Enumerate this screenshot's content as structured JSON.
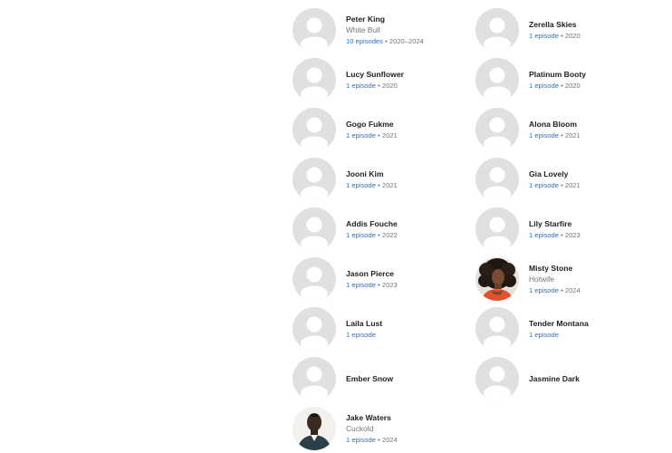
{
  "cast": {
    "left": [
      {
        "name": "Peter King",
        "role": "White Bull",
        "episodes": "10 episodes",
        "years": "2020–2024",
        "photo": false
      },
      {
        "name": "Lucy Sunflower",
        "role": "",
        "episodes": "1 episode",
        "years": "2020",
        "photo": false
      },
      {
        "name": "Gogo Fukme",
        "role": "",
        "episodes": "1 episode",
        "years": "2021",
        "photo": false
      },
      {
        "name": "Jooni Kim",
        "role": "",
        "episodes": "1 episode",
        "years": "2021",
        "photo": false
      },
      {
        "name": "Addis Fouche",
        "role": "",
        "episodes": "1 episode",
        "years": "2022",
        "photo": false
      },
      {
        "name": "Jason Pierce",
        "role": "",
        "episodes": "1 episode",
        "years": "2023",
        "photo": false
      },
      {
        "name": "Laila Lust",
        "role": "",
        "episodes": "1 episode",
        "years": "",
        "photo": false
      },
      {
        "name": "Ember Snow",
        "role": "",
        "episodes": "",
        "years": "",
        "photo": false
      },
      {
        "name": "Jake Waters",
        "role": "Cuckold",
        "episodes": "1 episode",
        "years": "2024",
        "photo": true
      }
    ],
    "right": [
      {
        "name": "Zerella Skies",
        "role": "",
        "episodes": "1 episode",
        "years": "2020",
        "photo": false
      },
      {
        "name": "Platinum Booty",
        "role": "",
        "episodes": "1 episode",
        "years": "2020",
        "photo": false
      },
      {
        "name": "Alona Bloom",
        "role": "",
        "episodes": "1 episode",
        "years": "2021",
        "photo": false
      },
      {
        "name": "Gia Lovely",
        "role": "",
        "episodes": "1 episode",
        "years": "2021",
        "photo": false
      },
      {
        "name": "Lily Starfire",
        "role": "",
        "episodes": "1 episode",
        "years": "2023",
        "photo": false
      },
      {
        "name": "Misty Stone",
        "role": "Hotwife",
        "episodes": "1 episode",
        "years": "2024",
        "photo": true
      },
      {
        "name": "Tender Montana",
        "role": "",
        "episodes": "1 episode",
        "years": "",
        "photo": false
      },
      {
        "name": "Jasmine Dark",
        "role": "",
        "episodes": "",
        "years": "",
        "photo": false
      }
    ]
  },
  "separator": "•",
  "colors": {
    "link": "#1a73e8",
    "muted": "#70757a",
    "name": "#202124",
    "placeholder_bg": "#e0e0e0",
    "placeholder_fg": "#ffffff"
  }
}
